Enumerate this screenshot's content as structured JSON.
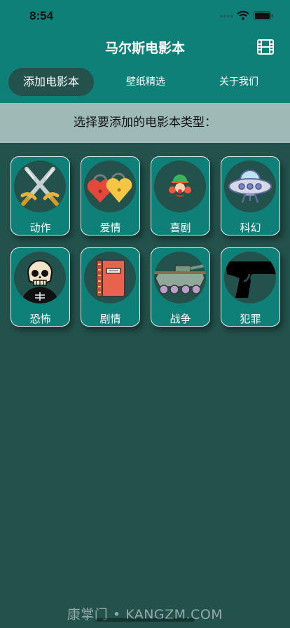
{
  "status_bar": {
    "time": "8:54"
  },
  "header": {
    "title": "马尔斯电影本",
    "film_icon": "film-icon"
  },
  "tabs": [
    {
      "label": "添加电影本",
      "active": true
    },
    {
      "label": "壁纸精选",
      "active": false
    },
    {
      "label": "关于我们",
      "active": false
    }
  ],
  "prompt": "选择要添加的电影本类型：",
  "genres": [
    {
      "label": "动作",
      "icon": "crossed-swords-icon"
    },
    {
      "label": "爱情",
      "icon": "heart-padlocks-icon"
    },
    {
      "label": "喜剧",
      "icon": "clown-icon"
    },
    {
      "label": "科幻",
      "icon": "ufo-icon"
    },
    {
      "label": "恐怖",
      "icon": "skull-icon"
    },
    {
      "label": "剧情",
      "icon": "book-icon"
    },
    {
      "label": "战争",
      "icon": "tank-icon"
    },
    {
      "label": "犯罪",
      "icon": "pistol-icon"
    }
  ],
  "watermark": "康掌门 • KANGZM.COM",
  "colors": {
    "header_bg": "#0e8077",
    "body_bg": "#23514b",
    "prompt_bg": "#9dbab6"
  }
}
